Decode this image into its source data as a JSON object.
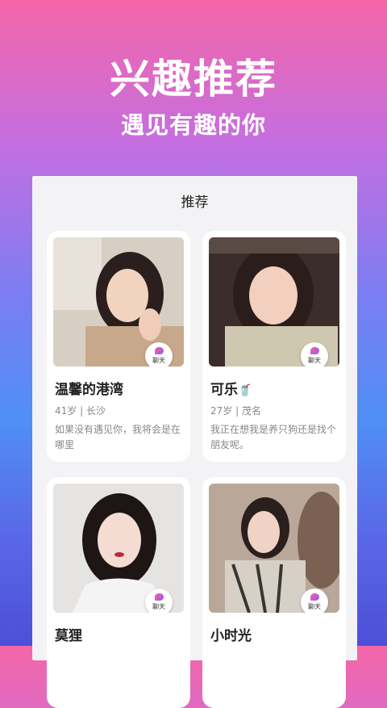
{
  "hero": {
    "title": "兴趣推荐",
    "subtitle": "遇见有趣的你"
  },
  "panel": {
    "title": "推荐"
  },
  "chat_label": "聊天",
  "cards": [
    {
      "name": "温馨的港湾",
      "meta": "41岁 | 长沙",
      "bio": "如果没有遇见你，我将会是在哪里"
    },
    {
      "name": "可乐",
      "emoji": "🥤",
      "meta": "27岁 | 茂名",
      "bio": "我正在想我是养只狗还是找个朋友呢。"
    },
    {
      "name": "莫狸",
      "meta": "",
      "bio": ""
    },
    {
      "name": "小时光",
      "meta": "",
      "bio": ""
    }
  ]
}
